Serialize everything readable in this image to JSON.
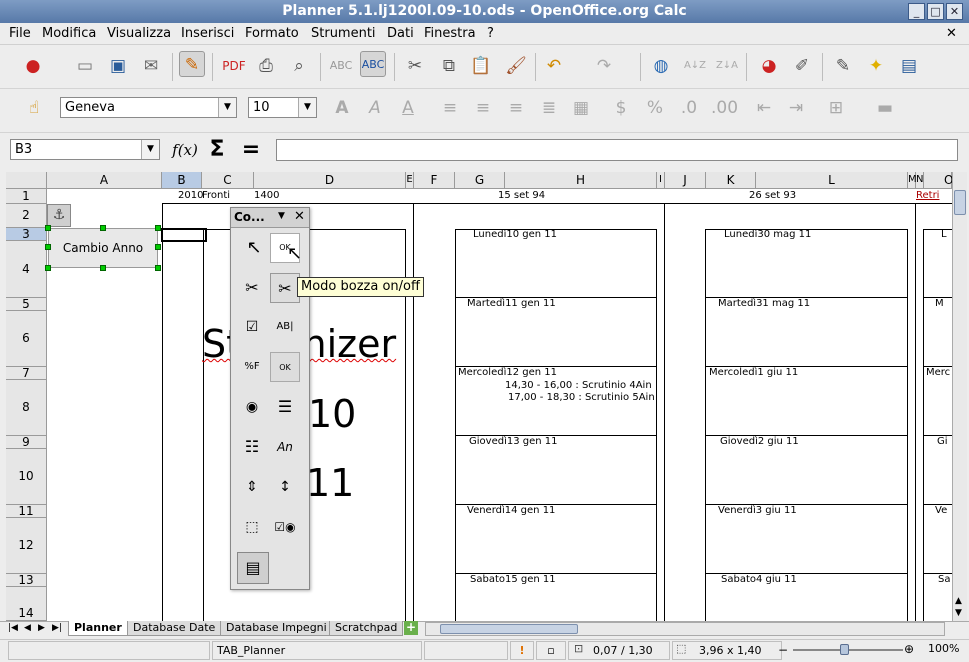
{
  "window": {
    "title": "Planner 5.1.lj1200l.09-10.ods - OpenOffice.org Calc"
  },
  "menu": [
    "File",
    "Modifica",
    "Visualizza",
    "Inserisci",
    "Formato",
    "Strumenti",
    "Dati",
    "Finestra",
    "?"
  ],
  "formatting": {
    "font": "Geneva",
    "size": "10"
  },
  "formula_bar": {
    "cell_ref": "B3",
    "fx": "f(x)",
    "sum": "Σ",
    "equals": "="
  },
  "columns": [
    "A",
    "B",
    "C",
    "D",
    "E",
    "F",
    "G",
    "H",
    "I",
    "J",
    "K",
    "L",
    "M",
    "N",
    "O"
  ],
  "rows": [
    "1",
    "2",
    "3",
    "4",
    "5",
    "6",
    "7",
    "8",
    "9",
    "10",
    "11",
    "12",
    "13",
    "14"
  ],
  "row1": {
    "b": "2010",
    "c": "Fronti",
    "c2": "1400",
    "h": "15 set 94",
    "l": "26 set 93",
    "o": "Retri"
  },
  "button_cambio": "Cambio Anno",
  "big_text": {
    "line1": "Stor inizer",
    "line2": "10",
    "line3": "11"
  },
  "week1": [
    {
      "day": "Lunedì10 gen 11"
    },
    {
      "day": "Martedì11 gen 11"
    },
    {
      "day": "Mercoledì12 gen 11",
      "events": [
        "14,30 - 16,00 : Scrutinio 4Ain",
        "17,00 - 18,30 : Scrutinio 5Ain"
      ]
    },
    {
      "day": "Giovedì13 gen 11"
    },
    {
      "day": "Venerdì14 gen 11"
    },
    {
      "day": "Sabato15 gen 11"
    }
  ],
  "week2": [
    {
      "day": "Lunedì30 mag 11"
    },
    {
      "day": "Martedì31 mag 11"
    },
    {
      "day": "Mercoledì1 giu 11"
    },
    {
      "day": "Giovedì2 giu 11"
    },
    {
      "day": "Venerdì3 giu 11"
    },
    {
      "day": "Sabato4 giu 11"
    }
  ],
  "week3_partial": [
    "L",
    "M",
    "Merc",
    "Gi",
    "Ve",
    "Sa"
  ],
  "controls_panel": {
    "title": "Co...",
    "tooltip": "Modo bozza on/off"
  },
  "sheet_tabs": [
    "Planner",
    "Database Date",
    "Database Impegni",
    "Scratchpad"
  ],
  "status": {
    "style": "TAB_Planner",
    "position": "0,07 / 1,30",
    "size": "3,96 x 1,40",
    "zoom": "100%"
  }
}
